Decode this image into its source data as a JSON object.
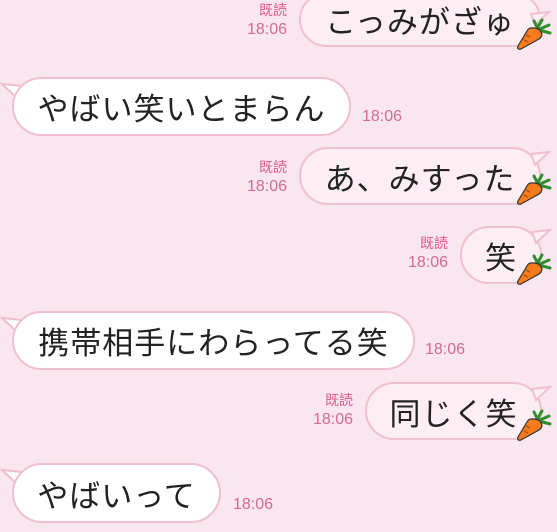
{
  "theme": {
    "background": "#fae6ee",
    "outgoing_bubble": "#fceef3",
    "incoming_bubble": "#ffffff",
    "bubble_border": "#f0bfd0",
    "read_color": "#e05a8a",
    "time_color": "#d46a90",
    "sticker": "carrot-icon"
  },
  "messages": [
    {
      "direction": "outgoing",
      "text": "こっみがざゅ",
      "read": "既読",
      "time": "18:06"
    },
    {
      "direction": "incoming",
      "text": "やばい笑いとまらん",
      "time": "18:06"
    },
    {
      "direction": "outgoing",
      "text": "あ、みすった",
      "read": "既読",
      "time": "18:06"
    },
    {
      "direction": "outgoing",
      "text": "笑",
      "read": "既読",
      "time": "18:06"
    },
    {
      "direction": "incoming",
      "text": "携帯相手にわらってる笑",
      "time": "18:06"
    },
    {
      "direction": "outgoing",
      "text": "同じく笑",
      "read": "既読",
      "time": "18:06"
    },
    {
      "direction": "incoming",
      "text": "やばいって",
      "time": "18:06"
    }
  ]
}
